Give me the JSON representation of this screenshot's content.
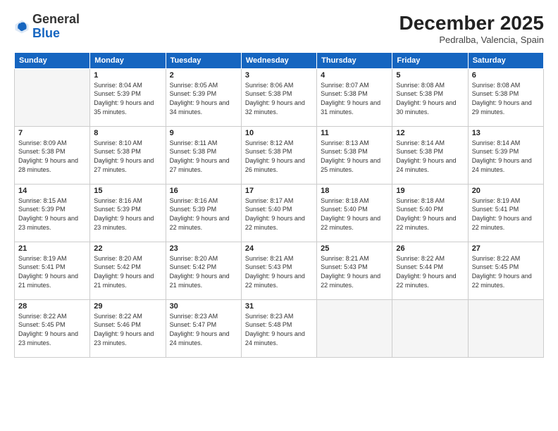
{
  "header": {
    "logo_general": "General",
    "logo_blue": "Blue",
    "month_title": "December 2025",
    "location": "Pedralba, Valencia, Spain"
  },
  "days_of_week": [
    "Sunday",
    "Monday",
    "Tuesday",
    "Wednesday",
    "Thursday",
    "Friday",
    "Saturday"
  ],
  "weeks": [
    [
      {
        "day": "",
        "empty": true
      },
      {
        "day": "1",
        "sunrise": "Sunrise: 8:04 AM",
        "sunset": "Sunset: 5:39 PM",
        "daylight": "Daylight: 9 hours and 35 minutes."
      },
      {
        "day": "2",
        "sunrise": "Sunrise: 8:05 AM",
        "sunset": "Sunset: 5:39 PM",
        "daylight": "Daylight: 9 hours and 34 minutes."
      },
      {
        "day": "3",
        "sunrise": "Sunrise: 8:06 AM",
        "sunset": "Sunset: 5:38 PM",
        "daylight": "Daylight: 9 hours and 32 minutes."
      },
      {
        "day": "4",
        "sunrise": "Sunrise: 8:07 AM",
        "sunset": "Sunset: 5:38 PM",
        "daylight": "Daylight: 9 hours and 31 minutes."
      },
      {
        "day": "5",
        "sunrise": "Sunrise: 8:08 AM",
        "sunset": "Sunset: 5:38 PM",
        "daylight": "Daylight: 9 hours and 30 minutes."
      },
      {
        "day": "6",
        "sunrise": "Sunrise: 8:08 AM",
        "sunset": "Sunset: 5:38 PM",
        "daylight": "Daylight: 9 hours and 29 minutes."
      }
    ],
    [
      {
        "day": "7",
        "sunrise": "Sunrise: 8:09 AM",
        "sunset": "Sunset: 5:38 PM",
        "daylight": "Daylight: 9 hours and 28 minutes."
      },
      {
        "day": "8",
        "sunrise": "Sunrise: 8:10 AM",
        "sunset": "Sunset: 5:38 PM",
        "daylight": "Daylight: 9 hours and 27 minutes."
      },
      {
        "day": "9",
        "sunrise": "Sunrise: 8:11 AM",
        "sunset": "Sunset: 5:38 PM",
        "daylight": "Daylight: 9 hours and 27 minutes."
      },
      {
        "day": "10",
        "sunrise": "Sunrise: 8:12 AM",
        "sunset": "Sunset: 5:38 PM",
        "daylight": "Daylight: 9 hours and 26 minutes."
      },
      {
        "day": "11",
        "sunrise": "Sunrise: 8:13 AM",
        "sunset": "Sunset: 5:38 PM",
        "daylight": "Daylight: 9 hours and 25 minutes."
      },
      {
        "day": "12",
        "sunrise": "Sunrise: 8:14 AM",
        "sunset": "Sunset: 5:38 PM",
        "daylight": "Daylight: 9 hours and 24 minutes."
      },
      {
        "day": "13",
        "sunrise": "Sunrise: 8:14 AM",
        "sunset": "Sunset: 5:39 PM",
        "daylight": "Daylight: 9 hours and 24 minutes."
      }
    ],
    [
      {
        "day": "14",
        "sunrise": "Sunrise: 8:15 AM",
        "sunset": "Sunset: 5:39 PM",
        "daylight": "Daylight: 9 hours and 23 minutes."
      },
      {
        "day": "15",
        "sunrise": "Sunrise: 8:16 AM",
        "sunset": "Sunset: 5:39 PM",
        "daylight": "Daylight: 9 hours and 23 minutes."
      },
      {
        "day": "16",
        "sunrise": "Sunrise: 8:16 AM",
        "sunset": "Sunset: 5:39 PM",
        "daylight": "Daylight: 9 hours and 22 minutes."
      },
      {
        "day": "17",
        "sunrise": "Sunrise: 8:17 AM",
        "sunset": "Sunset: 5:40 PM",
        "daylight": "Daylight: 9 hours and 22 minutes."
      },
      {
        "day": "18",
        "sunrise": "Sunrise: 8:18 AM",
        "sunset": "Sunset: 5:40 PM",
        "daylight": "Daylight: 9 hours and 22 minutes."
      },
      {
        "day": "19",
        "sunrise": "Sunrise: 8:18 AM",
        "sunset": "Sunset: 5:40 PM",
        "daylight": "Daylight: 9 hours and 22 minutes."
      },
      {
        "day": "20",
        "sunrise": "Sunrise: 8:19 AM",
        "sunset": "Sunset: 5:41 PM",
        "daylight": "Daylight: 9 hours and 22 minutes."
      }
    ],
    [
      {
        "day": "21",
        "sunrise": "Sunrise: 8:19 AM",
        "sunset": "Sunset: 5:41 PM",
        "daylight": "Daylight: 9 hours and 21 minutes."
      },
      {
        "day": "22",
        "sunrise": "Sunrise: 8:20 AM",
        "sunset": "Sunset: 5:42 PM",
        "daylight": "Daylight: 9 hours and 21 minutes."
      },
      {
        "day": "23",
        "sunrise": "Sunrise: 8:20 AM",
        "sunset": "Sunset: 5:42 PM",
        "daylight": "Daylight: 9 hours and 21 minutes."
      },
      {
        "day": "24",
        "sunrise": "Sunrise: 8:21 AM",
        "sunset": "Sunset: 5:43 PM",
        "daylight": "Daylight: 9 hours and 22 minutes."
      },
      {
        "day": "25",
        "sunrise": "Sunrise: 8:21 AM",
        "sunset": "Sunset: 5:43 PM",
        "daylight": "Daylight: 9 hours and 22 minutes."
      },
      {
        "day": "26",
        "sunrise": "Sunrise: 8:22 AM",
        "sunset": "Sunset: 5:44 PM",
        "daylight": "Daylight: 9 hours and 22 minutes."
      },
      {
        "day": "27",
        "sunrise": "Sunrise: 8:22 AM",
        "sunset": "Sunset: 5:45 PM",
        "daylight": "Daylight: 9 hours and 22 minutes."
      }
    ],
    [
      {
        "day": "28",
        "sunrise": "Sunrise: 8:22 AM",
        "sunset": "Sunset: 5:45 PM",
        "daylight": "Daylight: 9 hours and 23 minutes."
      },
      {
        "day": "29",
        "sunrise": "Sunrise: 8:22 AM",
        "sunset": "Sunset: 5:46 PM",
        "daylight": "Daylight: 9 hours and 23 minutes."
      },
      {
        "day": "30",
        "sunrise": "Sunrise: 8:23 AM",
        "sunset": "Sunset: 5:47 PM",
        "daylight": "Daylight: 9 hours and 24 minutes."
      },
      {
        "day": "31",
        "sunrise": "Sunrise: 8:23 AM",
        "sunset": "Sunset: 5:48 PM",
        "daylight": "Daylight: 9 hours and 24 minutes."
      },
      {
        "day": "",
        "empty": true
      },
      {
        "day": "",
        "empty": true
      },
      {
        "day": "",
        "empty": true
      }
    ]
  ]
}
